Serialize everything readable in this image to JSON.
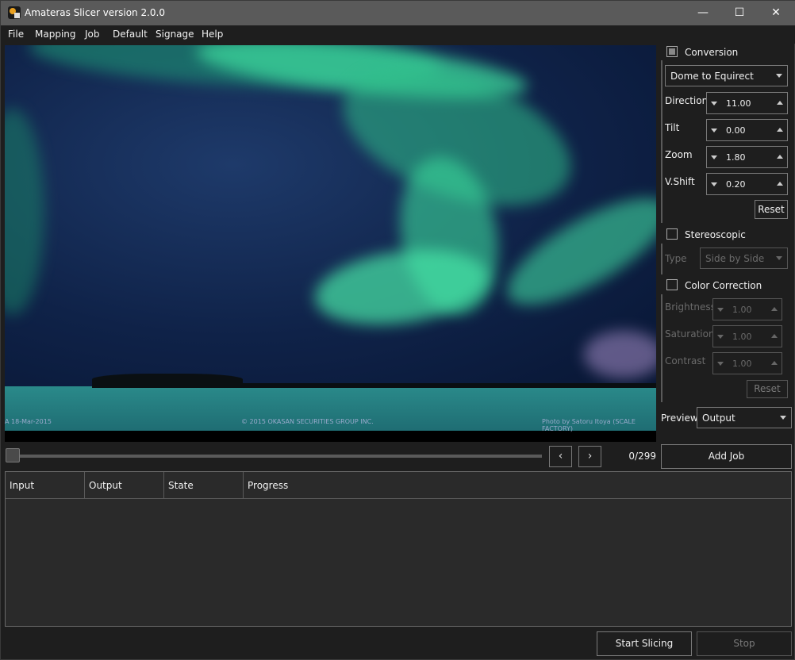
{
  "window": {
    "title": "Amateras Slicer version 2.0.0",
    "minimize": "—",
    "maximize": "☐",
    "close": "✕"
  },
  "menu": [
    "File",
    "Mapping",
    "Job",
    "Default",
    "Signage",
    "Help"
  ],
  "preview_image": {
    "watermark_left": "A 18-Mar-2015",
    "watermark_center": "© 2015  OKASAN SECURITIES GROUP INC.",
    "watermark_right": "Photo by Satoru Itoya (SCALE FACTORY)"
  },
  "navigation": {
    "prev_icon": "‹",
    "next_icon": "›",
    "frame_counter": "0/299"
  },
  "add_job": "Add Job",
  "table": {
    "columns": [
      "Input",
      "Output",
      "State",
      "Progress"
    ],
    "rows": []
  },
  "footer": {
    "start": "Start Slicing",
    "stop": "Stop"
  },
  "conversion": {
    "label": "Conversion",
    "checked": true,
    "mode": "Dome to Equirect",
    "fields": [
      {
        "label": "Direction",
        "value": "11.00"
      },
      {
        "label": "Tilt",
        "value": "0.00"
      },
      {
        "label": "Zoom",
        "value": "1.80"
      },
      {
        "label": "V.Shift",
        "value": "0.20"
      }
    ],
    "reset": "Reset"
  },
  "stereoscopic": {
    "label": "Stereoscopic",
    "checked": false,
    "type_label": "Type",
    "type_value": "Side by Side"
  },
  "color_correction": {
    "label": "Color Correction",
    "checked": false,
    "fields": [
      {
        "label": "Brightness",
        "value": "1.00"
      },
      {
        "label": "Saturation",
        "value": "1.00"
      },
      {
        "label": "Contrast",
        "value": "1.00"
      }
    ],
    "reset": "Reset"
  },
  "preview_select": {
    "label": "Preview",
    "value": "Output"
  },
  "colors": {
    "background": "#1e1e1e",
    "titlebar": "#5a5a5a",
    "aurora": "#3fe0a0"
  }
}
